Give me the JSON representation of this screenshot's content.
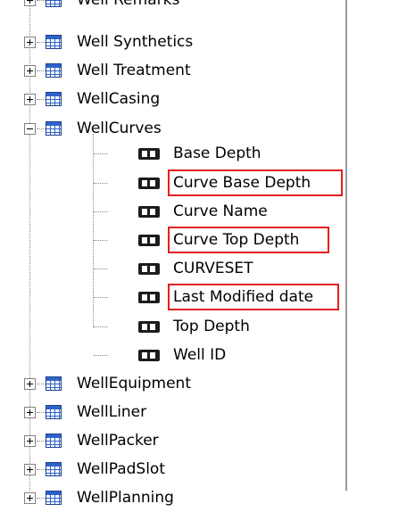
{
  "tree": {
    "top_partial_label": "Well Remarks",
    "tables_before": [
      {
        "label": "Well Synthetics"
      },
      {
        "label": "Well Treatment"
      },
      {
        "label": "WellCasing"
      }
    ],
    "expanded_table": {
      "label": "WellCurves",
      "fields": [
        {
          "label": "Base Depth",
          "highlighted": false
        },
        {
          "label": "Curve Base Depth",
          "highlighted": true
        },
        {
          "label": "Curve Name",
          "highlighted": false
        },
        {
          "label": "Curve Top Depth",
          "highlighted": true
        },
        {
          "label": "CURVESET",
          "highlighted": false
        },
        {
          "label": "Last Modified date",
          "highlighted": true
        },
        {
          "label": "Top Depth",
          "highlighted": false
        },
        {
          "label": "Well ID",
          "highlighted": false
        }
      ]
    },
    "tables_after": [
      {
        "label": "WellEquipment"
      },
      {
        "label": "WellLiner"
      },
      {
        "label": "WellPacker"
      },
      {
        "label": "WellPadSlot"
      }
    ],
    "bottom_partial_label": "WellPlanning"
  },
  "colors": {
    "highlight": "#e02020",
    "table_icon": "#2f63c9",
    "field_icon": "#1c1c1c"
  },
  "icons": {
    "expander_plus": "plus-box",
    "expander_minus": "minus-box",
    "table": "table-grid-icon",
    "field": "field-icon"
  }
}
